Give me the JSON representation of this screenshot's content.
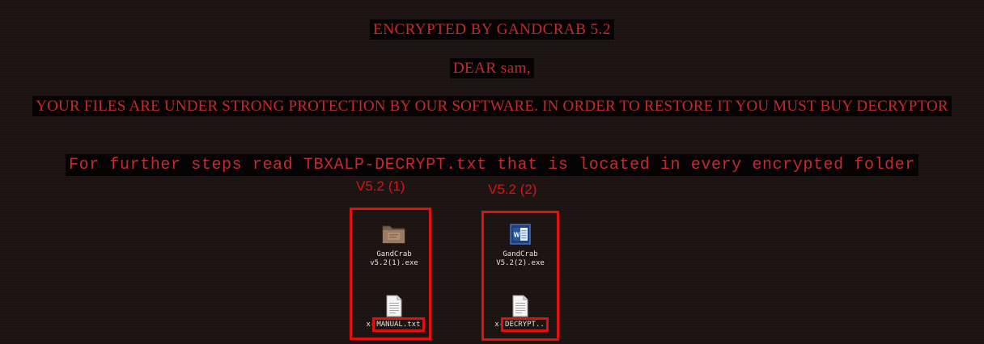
{
  "note": {
    "line1": "ENCRYPTED BY GANDCRAB 5.2",
    "line2": "DEAR sam,",
    "line3": "YOUR FILES ARE UNDER STRONG PROTECTION BY OUR SOFTWARE. IN ORDER TO RESTORE IT YOU MUST BUY DECRYPTOR",
    "line4": "For further steps read TBXALP-DECRYPT.txt that is located in every encrypted folder"
  },
  "panels": [
    {
      "caption": "V5.2 (1)",
      "exe": {
        "name_line1": "GandCrab",
        "name_line2": "v5.2(1).exe",
        "icon": "folder-exe-icon"
      },
      "txt": {
        "prefix": "x-",
        "name": "MANUAL.txt",
        "icon": "text-file-icon"
      }
    },
    {
      "caption": "V5.2 (2)",
      "exe": {
        "name_line1": "GandCrab",
        "name_line2": "V5.2(2).exe",
        "icon": "word-doc-icon"
      },
      "txt": {
        "prefix": "x-",
        "name": "DECRYPT..",
        "icon": "text-file-icon"
      }
    }
  ],
  "colors": {
    "background": "#1c1312",
    "note_text": "#c82a2a",
    "highlight_box": "#e01010"
  }
}
